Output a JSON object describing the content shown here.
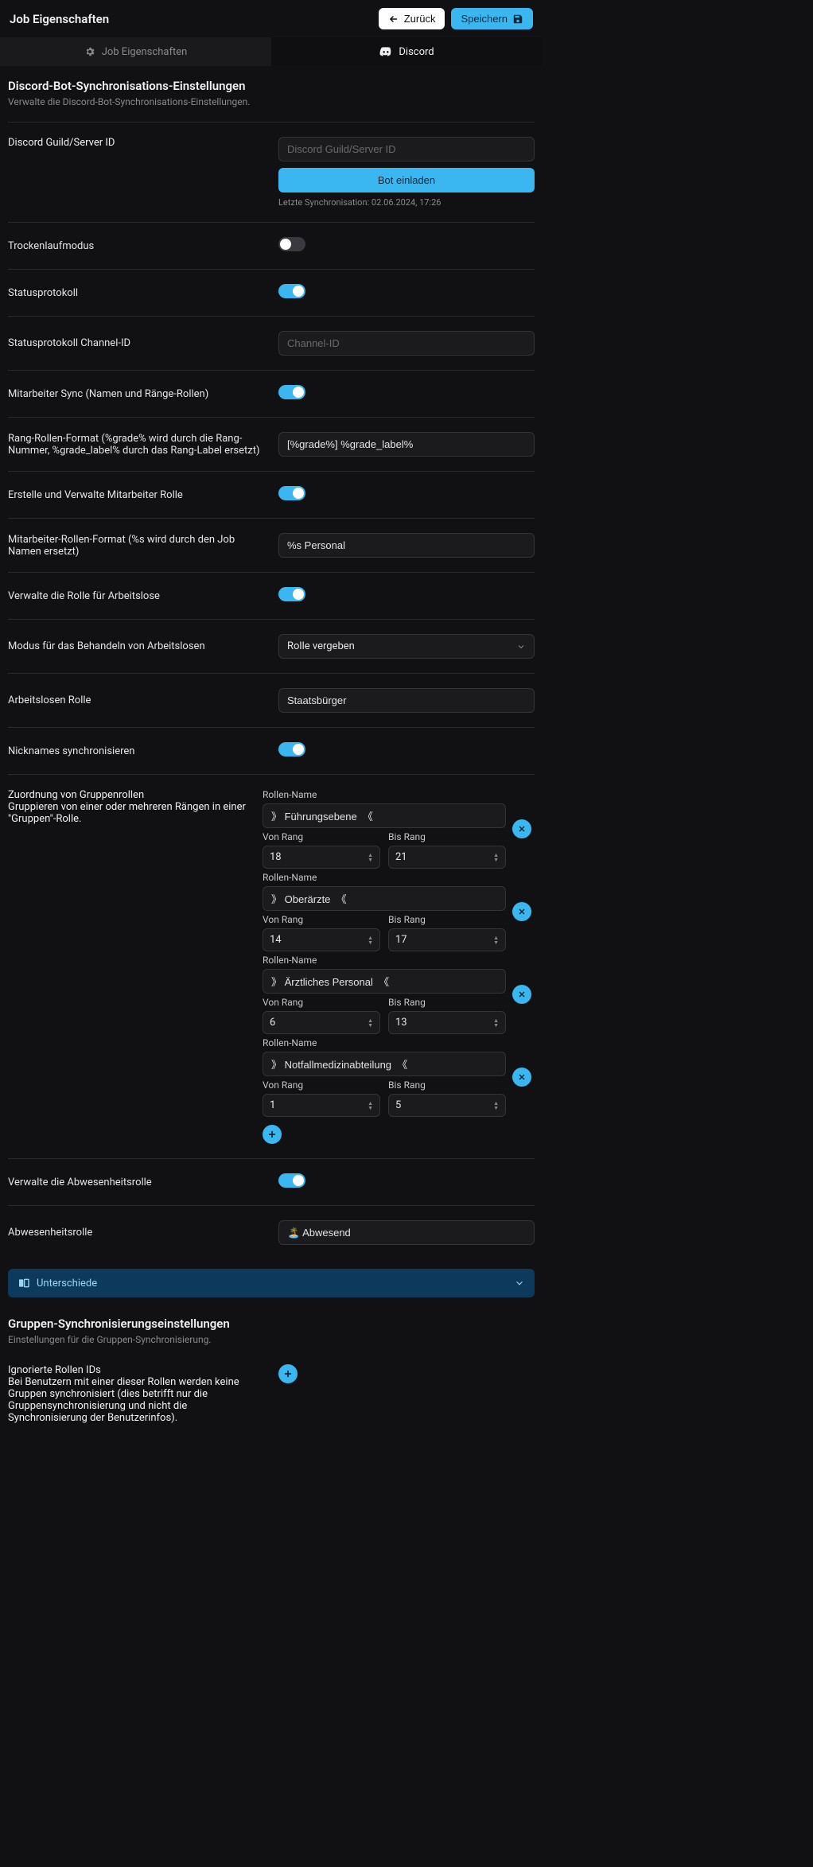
{
  "header": {
    "title": "Job Eigenschaften",
    "back": "Zurück",
    "save": "Speichern"
  },
  "tabs": {
    "props": "Job Eigenschaften",
    "discord": "Discord"
  },
  "section1": {
    "title": "Discord-Bot-Synchronisations-Einstellungen",
    "sub": "Verwalte die Discord-Bot-Synchronisations-Einstellungen."
  },
  "guild": {
    "label": "Discord Guild/Server ID",
    "placeholder": "Discord Guild/Server ID",
    "invite": "Bot einladen",
    "hint": "Letzte Synchronisation: 02.06.2024, 17:26"
  },
  "dryrun": {
    "label": "Trockenlaufmodus"
  },
  "statuslog": {
    "label": "Statusprotokoll"
  },
  "channel": {
    "label": "Statusprotokoll Channel-ID",
    "placeholder": "Channel-ID"
  },
  "empsync": {
    "label": "Mitarbeiter Sync (Namen und Ränge-Rollen)"
  },
  "rankfmt": {
    "label": "Rang-Rollen-Format (%grade% wird durch die Rang-Nummer, %grade_label% durch das Rang-Label ersetzt)",
    "value": "[%grade%] %grade_label%"
  },
  "manageemp": {
    "label": "Erstelle und Verwalte Mitarbeiter Rolle"
  },
  "emprolefmt": {
    "label": "Mitarbeiter-Rollen-Format (%s wird durch den Job Namen ersetzt)",
    "value": "%s Personal"
  },
  "unemprole": {
    "label": "Verwalte die Rolle für Arbeitslose"
  },
  "unempmode": {
    "label": "Modus für das Behandeln von Arbeitslosen",
    "value": "Rolle vergeben"
  },
  "unemprolename": {
    "label": "Arbeitslosen Rolle",
    "value": "Staatsbürger"
  },
  "nicksync": {
    "label": "Nicknames synchronisieren"
  },
  "groups": {
    "label": "Zuordnung von Gruppenrollen",
    "sub": "Gruppieren von einer oder mehreren Rängen in einer \"Gruppen\"-Rolle.",
    "rolename_label": "Rollen-Name",
    "from_label": "Von Rang",
    "to_label": "Bis Rang",
    "items": [
      {
        "name": "》 Führungsebene  《",
        "from": "18",
        "to": "21"
      },
      {
        "name": "》 Oberärzte  《",
        "from": "14",
        "to": "17"
      },
      {
        "name": "》 Ärztliches Personal  《",
        "from": "6",
        "to": "13"
      },
      {
        "name": "》 Notfallmedizinabteilung  《",
        "from": "1",
        "to": "5"
      }
    ]
  },
  "absence": {
    "label": "Verwalte die Abwesenheitsrolle"
  },
  "absencerole": {
    "label": "Abwesenheitsrolle",
    "value": "🏝️ Abwesend"
  },
  "diff": {
    "label": "Unterschiede"
  },
  "section2": {
    "title": "Gruppen-Synchronisierungseinstellungen",
    "sub": "Einstellungen für die Gruppen-Synchronisierung."
  },
  "ignored": {
    "label": "Ignorierte Rollen IDs",
    "sub": "Bei Benutzern mit einer dieser Rollen werden keine Gruppen synchronisiert (dies betrifft nur die Gruppensynchronisierung und nicht die Synchronisierung der Benutzerinfos)."
  }
}
